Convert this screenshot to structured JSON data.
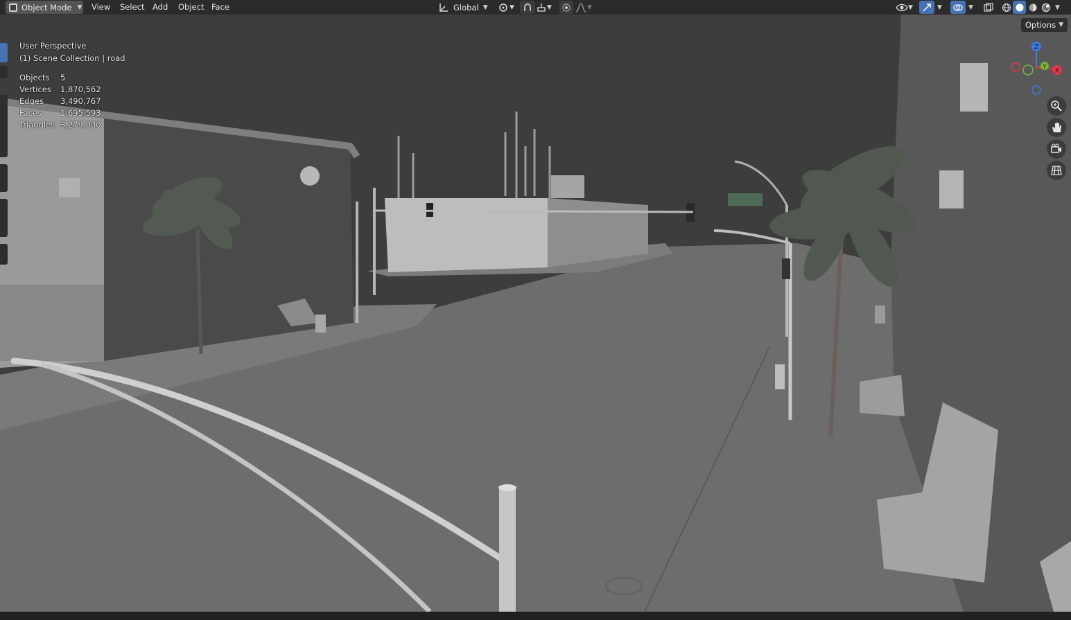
{
  "header": {
    "mode_label": "Object Mode",
    "menus": [
      "View",
      "Select",
      "Add",
      "Object",
      "Face"
    ],
    "transform_orientation": "Global",
    "icons": [
      "object-mode-icon",
      "transform-orientation-icon",
      "pivot-point-icon",
      "snap-icon",
      "snap-target-icon",
      "proportional-edit-icon",
      "proportional-falloff-icon",
      "visibility-selectability-icon",
      "gizmo-icon",
      "overlay-icon",
      "xray-icon",
      "wireframe-shading-icon",
      "solid-shading-icon",
      "material-shading-icon",
      "rendered-shading-icon"
    ]
  },
  "viewport": {
    "view_name": "User Perspective",
    "collection_info": "(1) Scene Collection | road",
    "stats": [
      {
        "label": "Objects",
        "value": "5"
      },
      {
        "label": "Vertices",
        "value": "1,870,562"
      },
      {
        "label": "Edges",
        "value": "3,490,767"
      },
      {
        "label": "Faces",
        "value": "1,695,593"
      },
      {
        "label": "Triangles",
        "value": "3,279,000"
      }
    ],
    "options_label": "Options",
    "gizmo_axes": [
      "Z",
      "Y",
      "X"
    ],
    "nav_icons": [
      "zoom-icon",
      "pan-hand-icon",
      "camera-view-icon",
      "perspective-grid-icon"
    ]
  },
  "colors": {
    "header_bg": "#2b2b2b",
    "active_blue": "#4772b3",
    "axis_x": "#e03a4a",
    "axis_y": "#7ab53a",
    "axis_z": "#3d7be0"
  }
}
